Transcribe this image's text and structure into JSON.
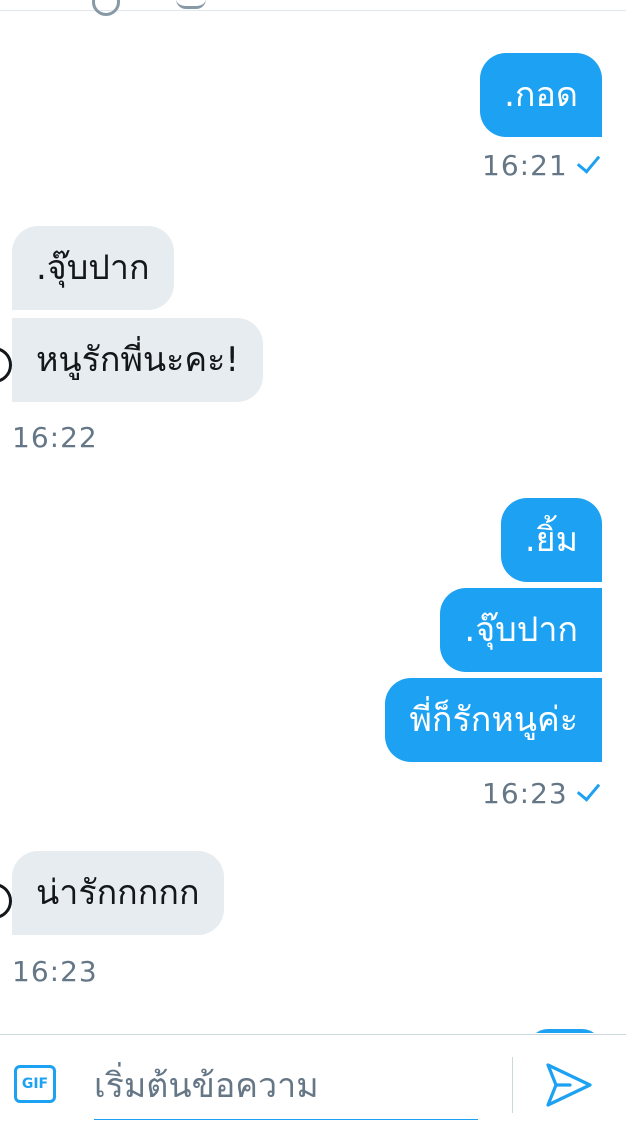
{
  "conversation": {
    "messages": [
      {
        "direction": "out",
        "text": ".กอด"
      },
      {
        "direction": "in",
        "text": ".จุ๊บปาก"
      },
      {
        "direction": "in",
        "text": "หนูรักพี่นะคะ!"
      },
      {
        "direction": "out",
        "text": ".ยิ้ม"
      },
      {
        "direction": "out",
        "text": ".จุ๊บปาก"
      },
      {
        "direction": "out",
        "text": "พี่ก็รักหนูค่ะ"
      },
      {
        "direction": "in",
        "text": "น่ารักกกกก"
      }
    ],
    "timestamps": [
      "16:21",
      "16:22",
      "16:23",
      "16:23"
    ],
    "read_receipt_icon": "checkmark-icon"
  },
  "composer": {
    "gif_label": "GIF",
    "placeholder": "เริ่มต้นข้อความ",
    "send_icon": "send-icon"
  },
  "colors": {
    "outgoing_bubble": "#1da1f2",
    "incoming_bubble": "#e6ecf0",
    "timestamp": "#657786",
    "accent": "#1da1f2"
  }
}
